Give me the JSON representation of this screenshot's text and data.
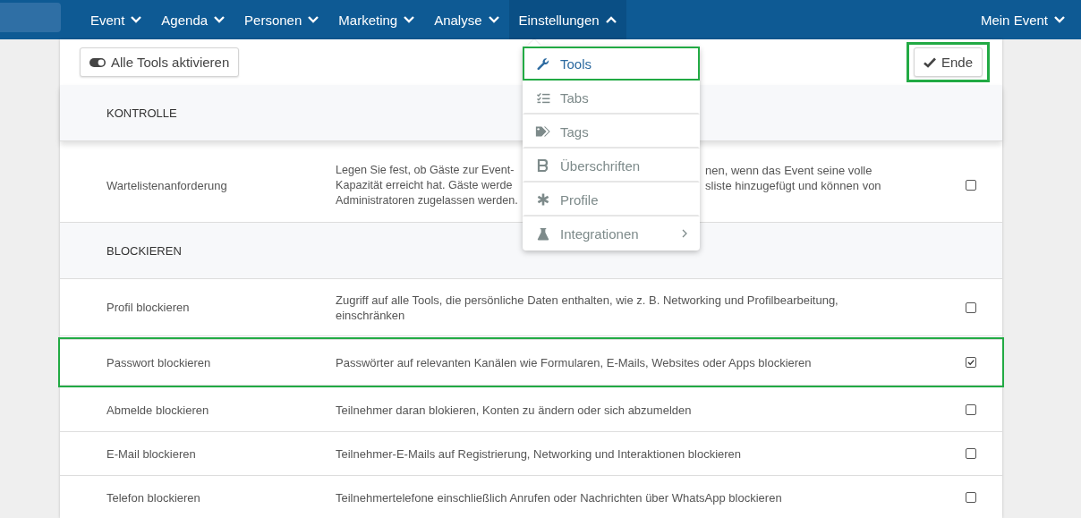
{
  "nav": {
    "items": [
      {
        "label": "Event",
        "expanded": false
      },
      {
        "label": "Agenda",
        "expanded": false
      },
      {
        "label": "Personen",
        "expanded": false
      },
      {
        "label": "Marketing",
        "expanded": false
      },
      {
        "label": "Analyse",
        "expanded": false
      },
      {
        "label": "Einstellungen",
        "expanded": true
      }
    ],
    "account": {
      "label": "Mein Event",
      "expanded": false
    }
  },
  "toolbar": {
    "toggle_button": "Alle Tools aktivieren",
    "done_button": {
      "label": "Ende",
      "highlighted": true
    }
  },
  "rows": [
    {
      "kind": "section",
      "label": "KONTROLLE"
    },
    {
      "kind": "setting",
      "name": "Wartelistenanforderung",
      "description_lines": [
        {
          "left": "Legen Sie fest, ob Gäste zur Event-",
          "right": "nen, wenn das Event seine volle"
        },
        {
          "left": "Kapazität erreicht hat. Gäste werde",
          "right": "sliste hinzugefügt und können von"
        },
        {
          "left": "Administratoren zugelassen werden."
        }
      ],
      "checked": false,
      "highlighted": false
    },
    {
      "kind": "section",
      "label": "BLOCKIEREN"
    },
    {
      "kind": "setting",
      "name": "Profil blockieren",
      "description": "Zugriff auf alle Tools, die persönliche Daten enthalten, wie z. B. Networking und Profilbearbeitung, einschränken",
      "checked": false,
      "highlighted": false
    },
    {
      "kind": "setting",
      "name": "Passwort blockieren",
      "description": "Passwörter auf relevanten Kanälen wie Formularen, E-Mails, Websites oder Apps blockieren",
      "checked": true,
      "highlighted": true
    },
    {
      "kind": "setting",
      "name": "Abmelde blockieren",
      "description": "Teilnehmer daran blokieren, Konten zu ändern oder sich abzumelden",
      "checked": false,
      "highlighted": false
    },
    {
      "kind": "setting",
      "name": "E-Mail blockieren",
      "description": "Teilnehmer-E-Mails auf Registrierung, Networking und Interaktionen blockieren",
      "checked": false,
      "highlighted": false
    },
    {
      "kind": "setting",
      "name": "Telefon blockieren",
      "description": "Teilnehmertelefone einschließlich Anrufen oder Nachrichten über WhatsApp blockieren",
      "checked": false,
      "highlighted": false
    }
  ],
  "menu": {
    "items": [
      {
        "kind": "wrench",
        "label": "Tools",
        "selected": true,
        "highlighted": true
      },
      {
        "kind": "checklist",
        "label": "Tabs",
        "selected": false,
        "highlighted": false
      },
      {
        "kind": "tags",
        "label": "Tags",
        "selected": false,
        "highlighted": false
      },
      {
        "kind": "bold",
        "label": "Überschriften",
        "selected": false,
        "highlighted": false
      },
      {
        "kind": "asterisk",
        "label": "Profile",
        "selected": false,
        "highlighted": false
      },
      {
        "kind": "flask",
        "label": "Integrationen",
        "selected": false,
        "highlighted": false,
        "submenu": true
      }
    ]
  }
}
